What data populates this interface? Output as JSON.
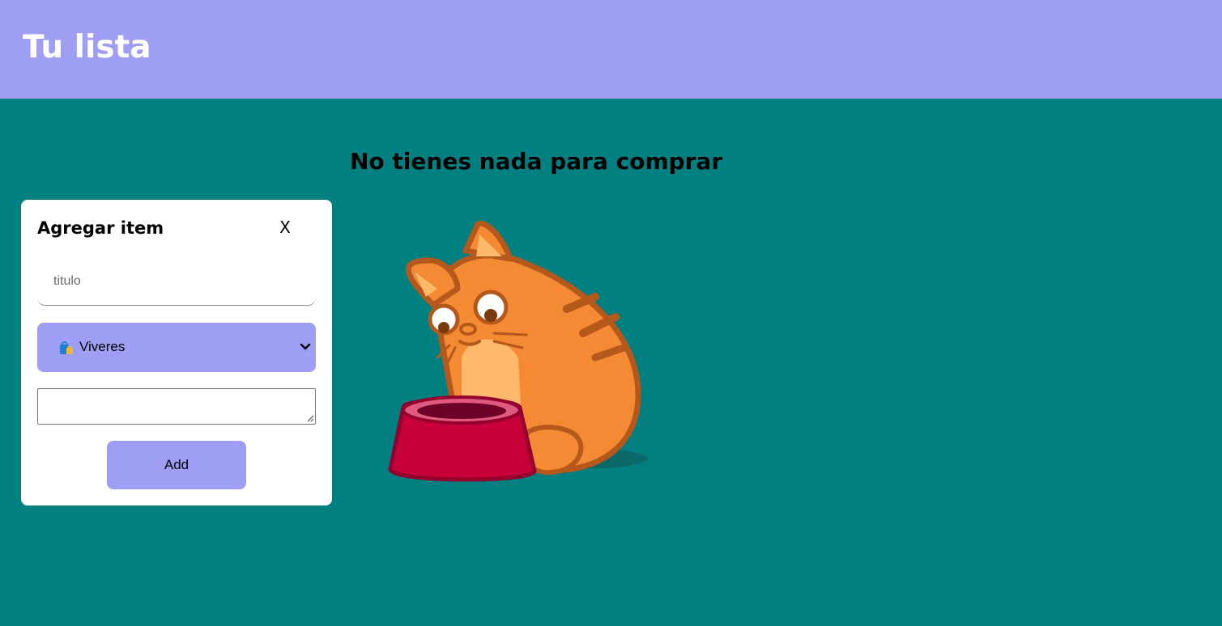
{
  "header": {
    "title": "Tu lista"
  },
  "main": {
    "empty_message": "No tienes nada para comprar"
  },
  "illustration": {
    "name": "cat-empty-bowl"
  },
  "form": {
    "title": "Agregar item",
    "close_label": "X",
    "title_placeholder": "titulo",
    "title_value": "",
    "category": {
      "selected": "Viveres",
      "icon": "shopping-bags-icon"
    },
    "notes_value": "",
    "add_label": "Add"
  },
  "colors": {
    "header_bg": "#9e9ef5",
    "page_bg": "#008080",
    "accent": "#9e9ef5",
    "panel_bg": "#ffffff"
  }
}
